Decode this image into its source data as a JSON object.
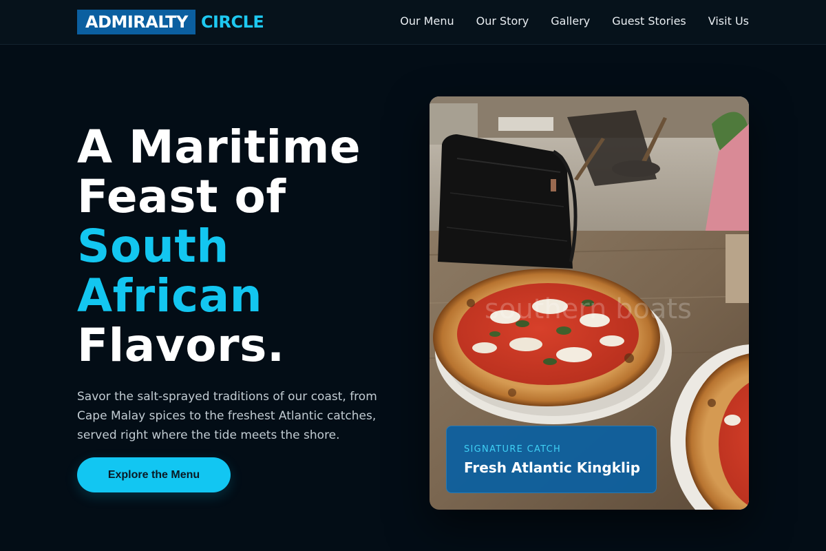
{
  "brand": {
    "name_box": "ADMIRALTY",
    "name_text": "CIRCLE"
  },
  "nav": {
    "items": [
      {
        "label": "Our Menu"
      },
      {
        "label": "Our Story"
      },
      {
        "label": "Gallery"
      },
      {
        "label": "Guest Stories"
      },
      {
        "label": "Visit Us"
      }
    ]
  },
  "hero": {
    "title_lines": [
      {
        "text": "A Maritime"
      },
      {
        "text": "Feast of"
      },
      {
        "text": "South"
      },
      {
        "text": "African"
      },
      {
        "text": "Flavors."
      }
    ],
    "description": "Savor the salt-sprayed traditions of our coast, from Cape Malay spices to the freshest Atlantic catches, served right where the tide meets the shore.",
    "cta_label": "Explore the Menu"
  },
  "feature": {
    "photo_watermark": "southern boats",
    "caption_tag": "SIGNATURE CATCH",
    "caption_title": "Fresh Atlantic Kingklip"
  },
  "colors": {
    "background": "#030d16",
    "accent": "#13c6f0",
    "brand_blue": "#0b5fa0"
  }
}
